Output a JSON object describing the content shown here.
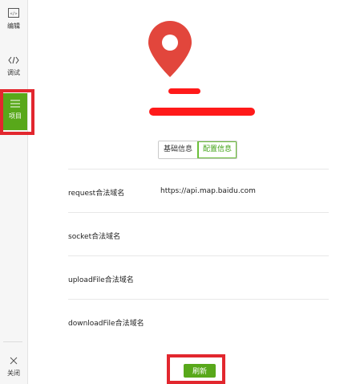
{
  "sidebar": {
    "items": [
      {
        "label": "编辑",
        "icon": "code-file-icon"
      },
      {
        "label": "调试",
        "icon": "code-brackets-icon"
      },
      {
        "label": "项目",
        "icon": "menu-icon"
      }
    ],
    "close_label": "关闭",
    "active_color": "#58a81a"
  },
  "project": {
    "logo_icon": "map-pin-icon",
    "logo_color": "#e2463c"
  },
  "tabs": [
    {
      "label": "基础信息",
      "active": false
    },
    {
      "label": "配置信息",
      "active": true
    }
  ],
  "config_rows": [
    {
      "label": "request合法域名",
      "value": "https://api.map.baidu.com"
    },
    {
      "label": "socket合法域名",
      "value": ""
    },
    {
      "label": "uploadFile合法域名",
      "value": ""
    },
    {
      "label": "downloadFile合法域名",
      "value": ""
    }
  ],
  "refresh_label": "刷新",
  "highlight_color": "#e2272e"
}
